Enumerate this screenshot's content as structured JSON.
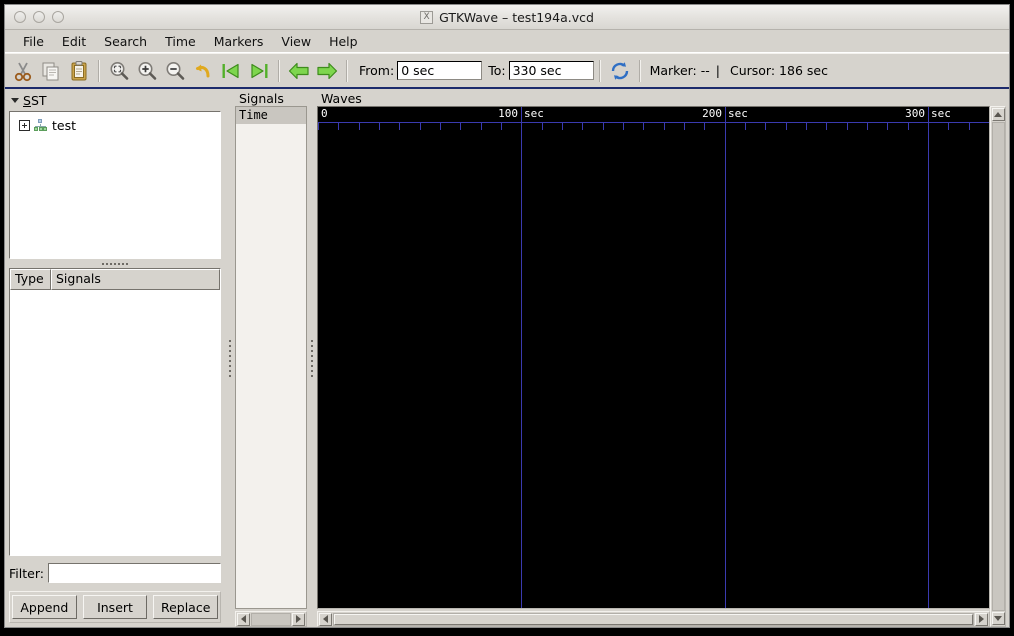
{
  "window": {
    "title": "GTKWave – test194a.vcd",
    "app_icon": "X",
    "buttons": [
      "window-close",
      "window-minimize",
      "window-maximize"
    ]
  },
  "menubar": {
    "items": [
      {
        "label": "File"
      },
      {
        "label": "Edit"
      },
      {
        "label": "Search"
      },
      {
        "label": "Time"
      },
      {
        "label": "Markers"
      },
      {
        "label": "View"
      },
      {
        "label": "Help"
      }
    ]
  },
  "toolbar": {
    "icons": [
      {
        "name": "cut-icon",
        "title": "Cut"
      },
      {
        "name": "copy-icon",
        "title": "Copy"
      },
      {
        "name": "paste-icon",
        "title": "Paste"
      },
      {
        "name": "zoom-fit-icon",
        "title": "Zoom Fit"
      },
      {
        "name": "zoom-in-icon",
        "title": "Zoom In"
      },
      {
        "name": "zoom-out-icon",
        "title": "Zoom Out"
      },
      {
        "name": "zoom-undo-icon",
        "title": "Zoom Undo"
      },
      {
        "name": "go-to-start-icon",
        "title": "Go To Start"
      },
      {
        "name": "go-to-end-icon",
        "title": "Go To End"
      },
      {
        "name": "back-arrow-icon",
        "title": "Back"
      },
      {
        "name": "forward-arrow-icon",
        "title": "Forward"
      },
      {
        "name": "reload-icon",
        "title": "Reload"
      }
    ],
    "from_label": "From:",
    "from_value": "0 sec",
    "to_label": "To:",
    "to_value": "330 sec",
    "marker_text": "Marker: --",
    "separator_text": "|",
    "cursor_text": "Cursor: 186 sec"
  },
  "sst": {
    "header_label": "SST",
    "header_mnemonic": "S",
    "header_rest": "ST",
    "tree": [
      {
        "label": "test",
        "expanded": false,
        "icon": "hierarchy-icon"
      }
    ]
  },
  "signal_table": {
    "columns": [
      "Type",
      "Signals"
    ],
    "rows": []
  },
  "filter": {
    "label": "Filter:",
    "value": "",
    "placeholder": ""
  },
  "action_buttons": [
    {
      "label": "Append",
      "name": "append-button"
    },
    {
      "label": "Insert",
      "name": "insert-button"
    },
    {
      "label": "Replace",
      "name": "replace-button"
    }
  ],
  "signals_pane": {
    "legend": "Signals",
    "rows": [
      {
        "label": "Time",
        "selected": true
      }
    ]
  },
  "waves_pane": {
    "legend": "Waves",
    "background_color": "#000000",
    "grid_color": "#3a3ab0",
    "ruler": {
      "origin_label": "0",
      "unit": "sec",
      "labels": [
        {
          "value": 100,
          "text": "100",
          "unit": "sec"
        },
        {
          "value": 200,
          "text": "200",
          "unit": "sec"
        },
        {
          "value": 300,
          "text": "300",
          "unit": "sec"
        }
      ],
      "minor_tick_interval": 10,
      "range_start": 0,
      "range_end": 330
    },
    "waveforms": []
  },
  "chart_data": {
    "type": "line",
    "title": "Waves",
    "xlabel": "sec",
    "ylabel": "",
    "xlim": [
      0,
      330
    ],
    "grid": true,
    "series": [],
    "annotations": [
      {
        "name": "cursor",
        "value": 186,
        "label": "Cursor: 186 sec"
      },
      {
        "name": "marker",
        "value": null,
        "label": "Marker: --"
      }
    ]
  }
}
